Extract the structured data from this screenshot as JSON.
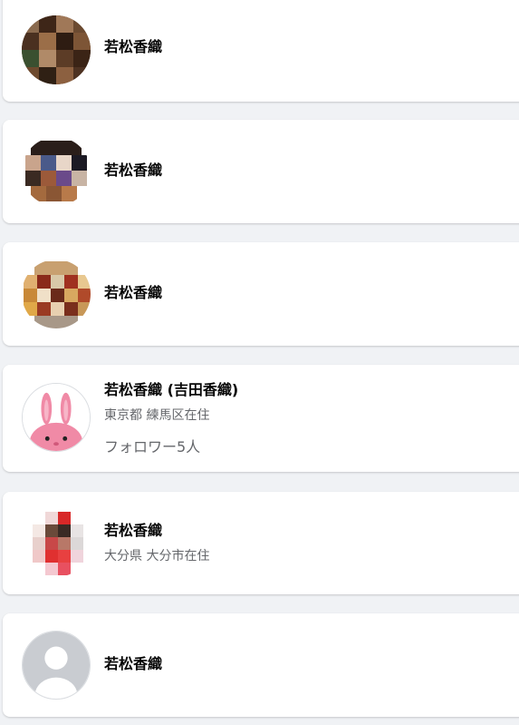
{
  "results": [
    {
      "name": "若松香織",
      "avatar": "pixelated-photo-avatar"
    },
    {
      "name": "若松香織",
      "avatar": "pixelated-photo-avatar"
    },
    {
      "name": "若松香織",
      "avatar": "pixelated-photo-avatar"
    },
    {
      "name": "若松香織 (吉田香織)",
      "location": "東京都 練馬区在住",
      "followers": "フォロワー5人",
      "avatar": "pink-rabbit-avatar"
    },
    {
      "name": "若松香織",
      "location": "大分県 大分市在住",
      "avatar": "pixelated-photo-avatar"
    },
    {
      "name": "若松香織",
      "avatar": "default-person-avatar"
    }
  ],
  "colors": {
    "page_background": "#f0f2f5",
    "card_background": "#ffffff",
    "name_text": "#050505",
    "secondary_text": "#65676b",
    "rabbit_pink": "#f08aa6",
    "default_avatar_gray": "#c9ccd1"
  }
}
